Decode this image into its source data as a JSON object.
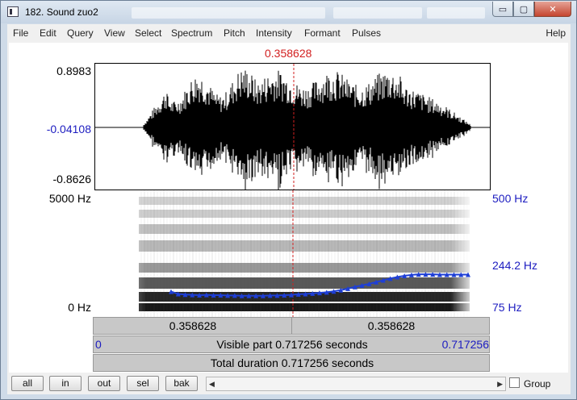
{
  "window": {
    "title": "182. Sound zuo2",
    "buttons": {
      "min": "▭",
      "restore": "▢",
      "close": "✕"
    }
  },
  "menu": [
    "File",
    "Edit",
    "Query",
    "View",
    "Select",
    "Spectrum",
    "Pitch",
    "Intensity",
    "Formant",
    "Pulses"
  ],
  "menu_help": "Help",
  "cursor_time": "0.358628",
  "waveform": {
    "ymax": "0.8983",
    "ymid": "-0.04108",
    "ymin": "-0.8626"
  },
  "spectrogram": {
    "fmax": "5000 Hz",
    "fmin": "0 Hz"
  },
  "pitch_axis": {
    "max": "500 Hz",
    "mid": "244.2 Hz",
    "min": "75 Hz"
  },
  "pitch_contour_hz": [
    160,
    152,
    150,
    149,
    148,
    149,
    148,
    148,
    147,
    147,
    146,
    146,
    146,
    146,
    147,
    147,
    148,
    149,
    151,
    152,
    154,
    156,
    158,
    161,
    165,
    170,
    176,
    181,
    186,
    192,
    198,
    204,
    209,
    213,
    216,
    218,
    218,
    218,
    217,
    217,
    217,
    217,
    217
  ],
  "selection_bar": {
    "left": "0.358628",
    "right": "0.358628"
  },
  "visible_bar": {
    "start": "0",
    "text": "Visible part 0.717256 seconds",
    "end": "0.717256"
  },
  "total_bar": {
    "text": "Total duration 0.717256 seconds"
  },
  "toolbar": {
    "all": "all",
    "in": "in",
    "out": "out",
    "sel": "sel",
    "bak": "bak",
    "group": "Group"
  },
  "colors": {
    "cursor": "#d21f1f",
    "pitch": "#1e3fd6",
    "axis_blue": "#1c1cc0"
  }
}
